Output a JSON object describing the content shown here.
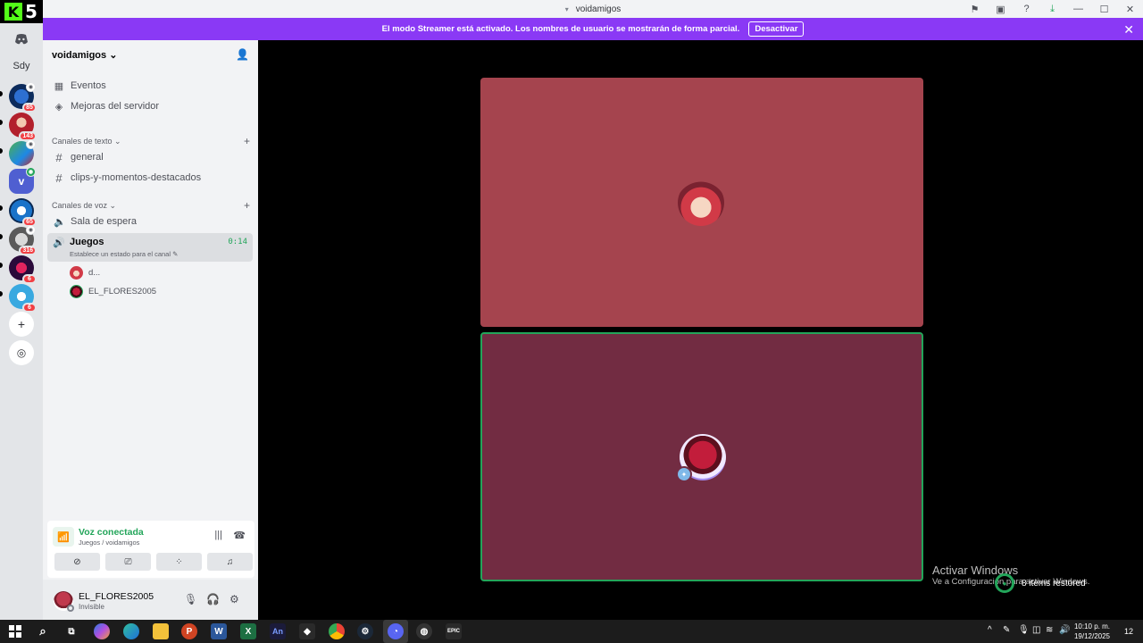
{
  "window": {
    "title": "voidamigos"
  },
  "banner": {
    "message": "El modo Streamer está activado. Los nombres de usuario se mostrarán de forma parcial.",
    "button": "Desactivar",
    "close": "✕"
  },
  "rail": {
    "label_short": "Sdy",
    "badges": [
      "85",
      "143",
      "65",
      "316",
      "6",
      "6"
    ],
    "colors": {
      "accent": "#5865f2",
      "badge": "#f23f43"
    }
  },
  "server": {
    "name": "voidamigos",
    "chevron": "⌄"
  },
  "sidebar": {
    "events": "Eventos",
    "boosts": "Mejoras del servidor",
    "text_category": "Canales de texto",
    "text_channels": [
      "general",
      "clips-y-momentos-destacados"
    ],
    "voice_category": "Canales de voz",
    "voice_channels": [
      "Sala de espera",
      "Juegos"
    ],
    "active_timer": "0:14",
    "active_status": "Establece un estado para el canal",
    "voice_users": [
      "d...",
      "EL_FLORES2005"
    ]
  },
  "voice_panel": {
    "title": "Voz conectada",
    "subtitle": "Juegos / voidamigos"
  },
  "user_panel": {
    "name": "EL_FLORES2005",
    "status": "Invisible"
  },
  "stage": {
    "tile_colors": [
      "#a5444e",
      "#722c42"
    ],
    "speaking_border": "#23a55a"
  },
  "watermark": {
    "title": "Activar Windows",
    "subtitle": "Ve a Configuración para activar Windows."
  },
  "restored": {
    "text": "8 items restored"
  },
  "taskbar": {
    "time": "10:10 p. m.",
    "date": "19/12/2025",
    "notifications": "12"
  }
}
